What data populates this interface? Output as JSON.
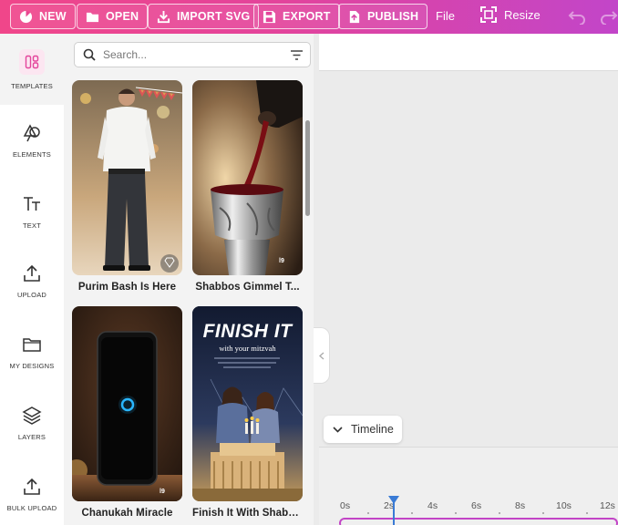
{
  "toolbar": {
    "new_label": "NEW",
    "open_label": "OPEN",
    "import_label": "IMPORT SVG",
    "export_label": "EXPORT",
    "publish_label": "PUBLISH",
    "file_label": "File",
    "resize_label": "Resize"
  },
  "sidebar": {
    "items": [
      {
        "label": "TEMPLATES",
        "icon": "templates-icon"
      },
      {
        "label": "ELEMENTS",
        "icon": "shapes-icon"
      },
      {
        "label": "TEXT",
        "icon": "text-icon"
      },
      {
        "label": "UPLOAD",
        "icon": "upload-icon"
      },
      {
        "label": "MY DESIGNS",
        "icon": "folder-icon"
      },
      {
        "label": "LAYERS",
        "icon": "layers-icon"
      },
      {
        "label": "BULK UPLOAD",
        "icon": "bulk-upload-icon"
      }
    ]
  },
  "search": {
    "placeholder": "Search..."
  },
  "templates": [
    {
      "title": "Purim Bash Is Here",
      "premium": true
    },
    {
      "title": "Shabbos Gimmel T..."
    },
    {
      "title": "Chanukah Miracle"
    },
    {
      "title": "Finish It With Shabb..."
    }
  ],
  "poster": {
    "headline": "FINISH IT",
    "subline": "with your mitzvah",
    "brand_mark": "l9"
  },
  "timeline": {
    "label": "Timeline",
    "ticks": [
      "0s",
      "2s",
      "4s",
      "6s",
      "8s",
      "10s",
      "12s"
    ]
  },
  "colors": {
    "toolbar_start": "#f0468a",
    "toolbar_end": "#c245c9",
    "playhead": "#3a7bd5",
    "track": "#c244c6"
  }
}
